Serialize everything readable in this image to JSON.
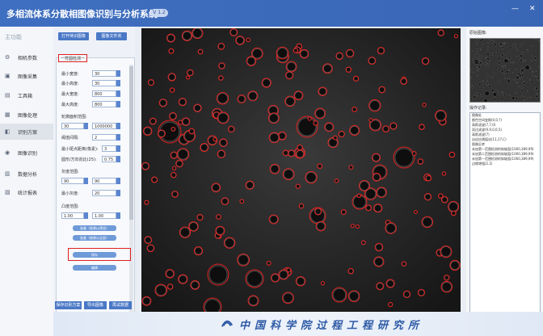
{
  "app": {
    "title": "多相流体系分散相图像识别与分析系统",
    "version": "V 1.2"
  },
  "window": {
    "minimize": "—",
    "close": "✕"
  },
  "sidebar": {
    "header": "主功能",
    "items": [
      {
        "label": "相机参数",
        "icon": "camera-settings-icon"
      },
      {
        "label": "图像采集",
        "icon": "image-capture-icon"
      },
      {
        "label": "工具箱",
        "icon": "toolbox-icon"
      },
      {
        "label": "图像处理",
        "icon": "image-processing-icon"
      },
      {
        "label": "识别方案",
        "icon": "recognition-scheme-icon",
        "active": true
      },
      {
        "label": "图像识别",
        "icon": "image-recognition-icon"
      },
      {
        "label": "数据分析",
        "icon": "data-analysis-icon"
      },
      {
        "label": "统计报表",
        "icon": "statistics-report-icon"
      }
    ]
  },
  "panel": {
    "open_image": "打开待识图像",
    "open_folder": "图像文件夹",
    "group_title": "一符圆检测一",
    "fields": {
      "min_size_label": "最小宽度:",
      "min_size": "30",
      "min_height_label": "最小高度:",
      "min_height": "30",
      "max_width_label": "最大宽度:",
      "max_width": "800",
      "max_height_label": "最大高度:",
      "max_height": "800",
      "area_range_label": "轮廓面积范围:",
      "area_min": "30",
      "area_max": "1000000",
      "step_label": "阈值间隔:",
      "step": "2",
      "min_dist_label": "最小斑点距离(像素):",
      "min_dist": "3",
      "circularity_label": "圆形/方向向比(25):",
      "circularity": "0.75",
      "gray_range_label": "灰度范围:",
      "gray_min": "90",
      "gray_max": "90",
      "min_gray_label": "最小灰度:",
      "min_gray": "20",
      "convexity_label": "凸度范围:",
      "convex_min": "1.00",
      "convex_max": "1.00"
    },
    "actions": {
      "apply_single": "准备（效果以预览）",
      "apply_all": "准备（效果以全部）",
      "save": "保存",
      "edit": "编辑"
    },
    "bottom": {
      "save_scheme": "保存识别方案",
      "export_image": "导出图像",
      "reset": "再试数据"
    }
  },
  "right": {
    "thumb_title": "原始图像:",
    "log_title": "操作记录:",
    "log": [
      "图像处",
      "颜色空间变换(0,0,?)",
      "高斯滤波(7,7,0)",
      "双边滤波(9,9,0,0,5)",
      "高斯滤波(7)",
      "自适应阈值化(11,17,C)",
      "图像反转",
      "未加第一范围检测的斜坡面(1000,389,99)",
      "未加第二范围检测的斜坡面(1000,389,99)",
      "未加第一范围检测的斜坡面(1000,389,99)",
      "边缘增强(2.2)"
    ]
  },
  "footer": {
    "organization": "中国科学院过程工程研究所"
  },
  "colors": {
    "accent": "#3f6fc0",
    "highlight": "#e02020",
    "detect": "#e02020"
  }
}
